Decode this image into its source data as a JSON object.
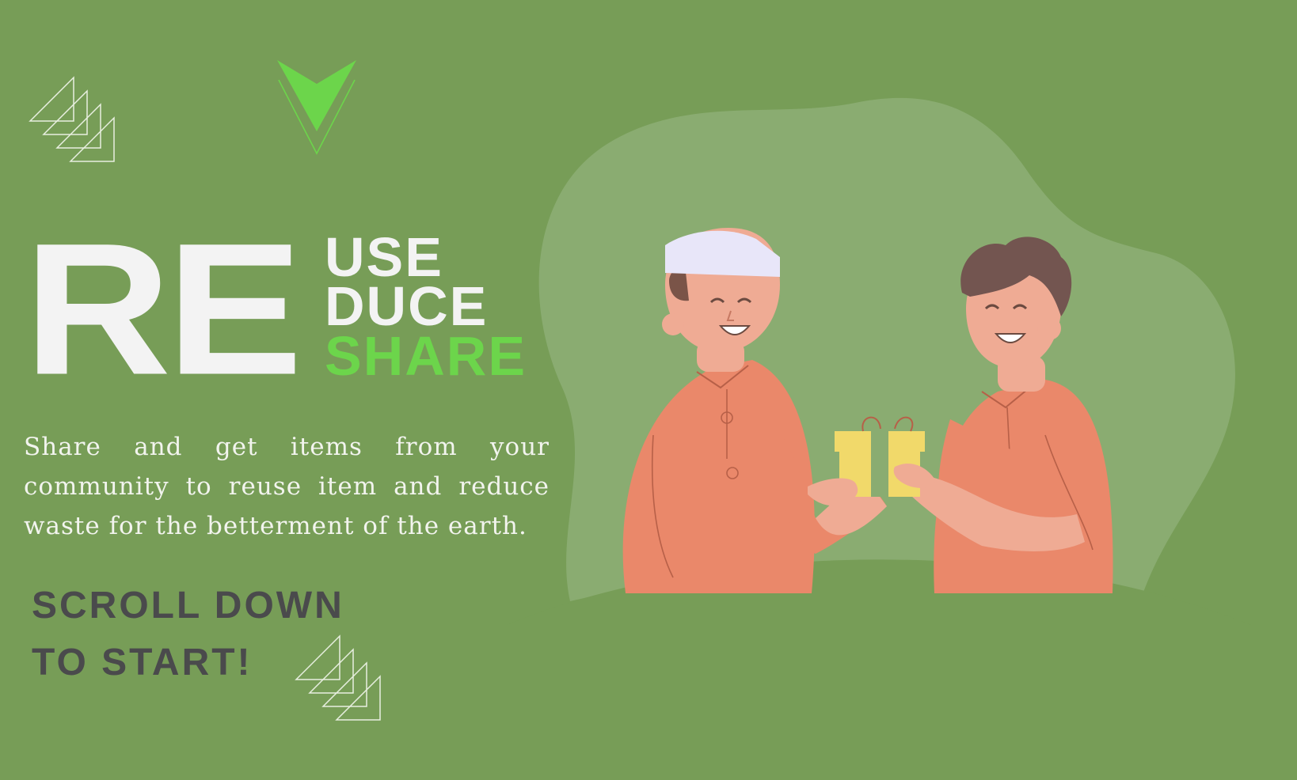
{
  "hero": {
    "big_prefix": "RE",
    "words": [
      "USE",
      "DUCE",
      "SHARE"
    ]
  },
  "description": "Share and get items from your community to reuse item and reduce waste for the betterment of the earth.",
  "cta": {
    "line1": "SCROLL DOWN",
    "line2": "TO START!"
  },
  "icons": {
    "scroll_indicator": "chevron-down-icon",
    "decoration": "stacked-triangles-icon",
    "illustration": "people-sharing-gift-illustration"
  },
  "colors": {
    "background": "#779d57",
    "accent_green": "#6cd54b",
    "title_white": "#f3f3f3",
    "cta_text": "#4a4a4c",
    "shirt": "#ea886a",
    "gift": "#f1d96a"
  }
}
